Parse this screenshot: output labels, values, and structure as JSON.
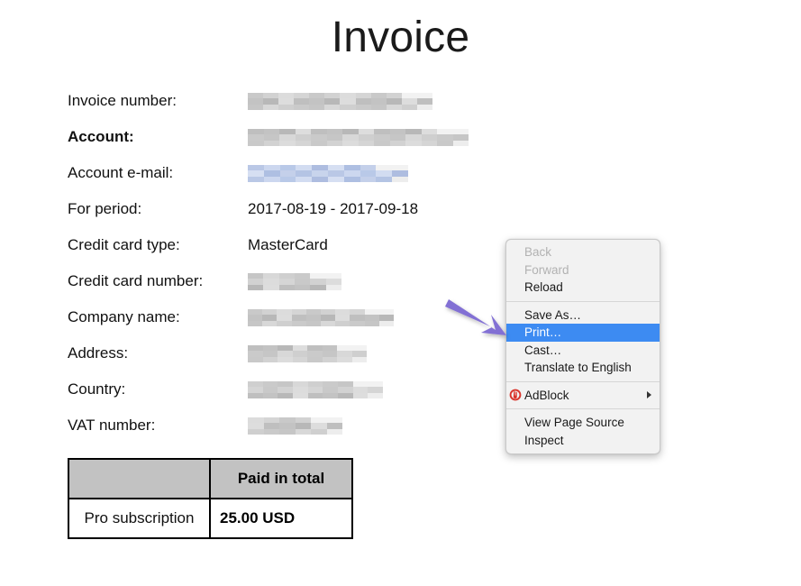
{
  "page": {
    "title": "Invoice"
  },
  "invoice": {
    "fields": [
      {
        "label": "Invoice number:",
        "bold": false,
        "value": null,
        "redacted": true,
        "redaction_style": "grey",
        "redaction_width": 205
      },
      {
        "label": "Account:",
        "bold": true,
        "value": null,
        "redacted": true,
        "redaction_style": "grey",
        "redaction_width": 245
      },
      {
        "label": "Account e-mail:",
        "bold": false,
        "value": null,
        "redacted": true,
        "redaction_style": "blue",
        "redaction_width": 178
      },
      {
        "label": "For period:",
        "bold": false,
        "value": "2017-08-19 - 2017-09-18",
        "redacted": false
      },
      {
        "label": "Credit card type:",
        "bold": false,
        "value": "MasterCard",
        "redacted": false
      },
      {
        "label": "Credit card number:",
        "bold": false,
        "value": null,
        "redacted": true,
        "redaction_style": "grey",
        "redaction_width": 104
      },
      {
        "label": "Company name:",
        "bold": false,
        "value": null,
        "redacted": true,
        "redaction_style": "grey",
        "redaction_width": 162
      },
      {
        "label": "Address:",
        "bold": false,
        "value": null,
        "redacted": true,
        "redaction_style": "grey",
        "redaction_width": 132
      },
      {
        "label": "Country:",
        "bold": false,
        "value": null,
        "redacted": true,
        "redaction_style": "grey",
        "redaction_width": 150
      },
      {
        "label": "VAT number:",
        "bold": false,
        "value": null,
        "redacted": true,
        "redaction_style": "grey",
        "redaction_width": 105
      }
    ]
  },
  "totals_table": {
    "header": {
      "blank": "",
      "total_label": "Paid in total"
    },
    "rows": [
      {
        "item": "Pro subscription",
        "amount": "25.00 USD"
      }
    ]
  },
  "context_menu": {
    "groups": [
      {
        "items": [
          {
            "label": "Back",
            "state": "disabled"
          },
          {
            "label": "Forward",
            "state": "disabled"
          },
          {
            "label": "Reload",
            "state": "normal"
          }
        ]
      },
      {
        "items": [
          {
            "label": "Save As…",
            "state": "normal"
          },
          {
            "label": "Print…",
            "state": "selected"
          },
          {
            "label": "Cast…",
            "state": "normal"
          },
          {
            "label": "Translate to English",
            "state": "normal"
          }
        ]
      },
      {
        "items": [
          {
            "label": "AdBlock",
            "state": "normal",
            "icon": "adblock-icon",
            "submenu": true
          }
        ]
      },
      {
        "items": [
          {
            "label": "View Page Source",
            "state": "normal"
          },
          {
            "label": "Inspect",
            "state": "normal"
          }
        ]
      }
    ]
  },
  "annotation": {
    "arrow_color": "#8270d4",
    "points_to": "Print…"
  },
  "colors": {
    "selection_blue": "#3d8bf2",
    "table_header_grey": "#c2c2c2",
    "menu_background": "#f2f2f2",
    "disabled_text": "#b2b2b2",
    "adblock_red": "#d9352c",
    "arrow_purple": "#8270d4"
  }
}
